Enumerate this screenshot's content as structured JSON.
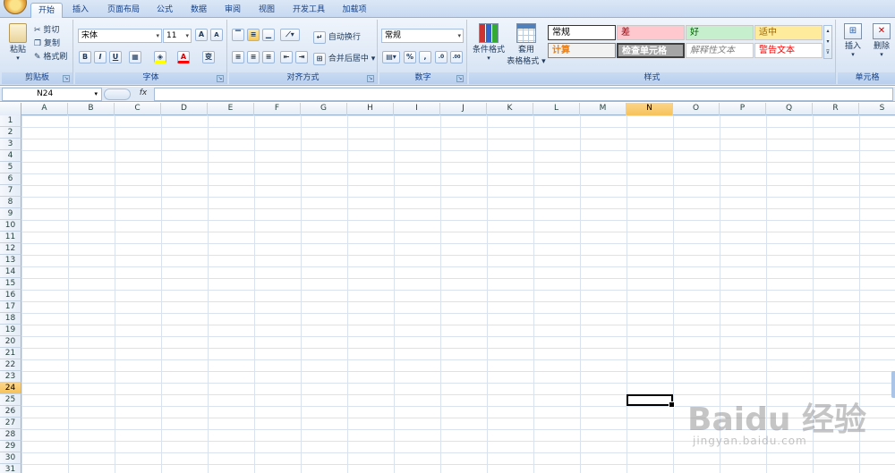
{
  "tabs": [
    "开始",
    "插入",
    "页面布局",
    "公式",
    "数据",
    "审阅",
    "视图",
    "开发工具",
    "加载项"
  ],
  "clipboard": {
    "paste": "粘贴",
    "cut": "剪切",
    "copy": "复制",
    "format_painter": "格式刷",
    "label": "剪贴板"
  },
  "font": {
    "name": "宋体",
    "size": "11",
    "grow": "A",
    "shrink": "A",
    "bold": "B",
    "italic": "I",
    "underline": "U",
    "font_color": "A",
    "phonetic": "变",
    "label": "字体"
  },
  "alignment": {
    "wrap": "自动换行",
    "merge": "合并后居中",
    "label": "对齐方式"
  },
  "number": {
    "format": "常规",
    "percent": "%",
    "comma": ",",
    "inc_decimal": ".0",
    "dec_decimal": ".00",
    "label": "数字"
  },
  "styles": {
    "conditional": "条件格式",
    "table_line1": "套用",
    "table_line2": "表格格式",
    "cells": [
      {
        "text": "常规",
        "bg": "#ffffff",
        "fg": "#000000"
      },
      {
        "text": "差",
        "bg": "#ffc7ce",
        "fg": "#9c0006"
      },
      {
        "text": "好",
        "bg": "#c6efce",
        "fg": "#006100"
      },
      {
        "text": "适中",
        "bg": "#ffeb9c",
        "fg": "#9c6500"
      },
      {
        "text": "计算",
        "bg": "#f2f2f2",
        "fg": "#fa7d00"
      },
      {
        "text": "检查单元格",
        "bg": "#a5a5a5",
        "fg": "#ffffff"
      },
      {
        "text": "解释性文本",
        "bg": "#ffffff",
        "fg": "#7f7f7f"
      },
      {
        "text": "警告文本",
        "bg": "#ffffff",
        "fg": "#ff0000"
      }
    ],
    "label": "样式"
  },
  "cells_group": {
    "insert": "插入",
    "delete": "删除",
    "label": "单元格"
  },
  "namebox": "N24",
  "fx": "fx",
  "columns": [
    "A",
    "B",
    "C",
    "D",
    "E",
    "F",
    "G",
    "H",
    "I",
    "J",
    "K",
    "L",
    "M",
    "N",
    "O",
    "P",
    "Q",
    "R",
    "S"
  ],
  "selected_column": "N",
  "rows": [
    "1",
    "2",
    "3",
    "4",
    "5",
    "6",
    "7",
    "8",
    "9",
    "10",
    "11",
    "12",
    "13",
    "14",
    "15",
    "16",
    "17",
    "18",
    "19",
    "20",
    "21",
    "22",
    "23",
    "24",
    "25",
    "26",
    "27",
    "28",
    "29",
    "30",
    "31"
  ],
  "selected_row": "24",
  "watermark": {
    "text": "Baidu 经验",
    "url": "jingyan.baidu.com"
  }
}
